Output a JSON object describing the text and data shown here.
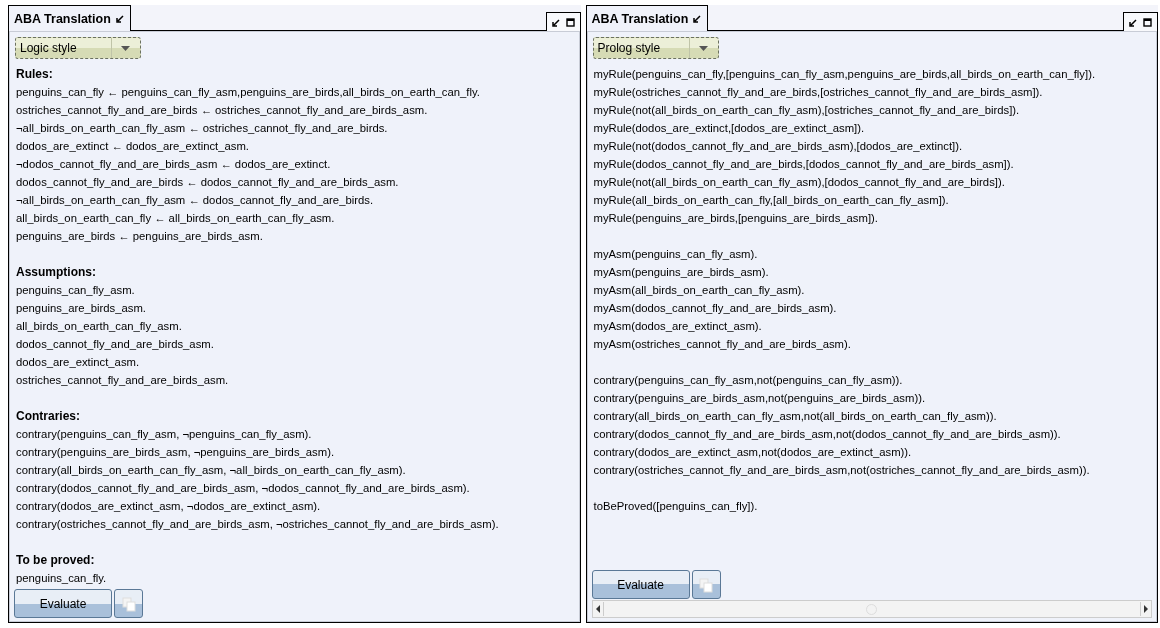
{
  "panels": [
    {
      "title": "ABA Translation",
      "dropdown": "Logic style",
      "has_scrollbar": false,
      "sections": [
        {
          "heading": "Rules:",
          "lines": [
            "penguins_can_fly ← penguins_can_fly_asm,penguins_are_birds,all_birds_on_earth_can_fly.",
            "ostriches_cannot_fly_and_are_birds ← ostriches_cannot_fly_and_are_birds_asm.",
            "¬all_birds_on_earth_can_fly_asm ← ostriches_cannot_fly_and_are_birds.",
            "dodos_are_extinct ← dodos_are_extinct_asm.",
            "¬dodos_cannot_fly_and_are_birds_asm ← dodos_are_extinct.",
            "dodos_cannot_fly_and_are_birds ← dodos_cannot_fly_and_are_birds_asm.",
            "¬all_birds_on_earth_can_fly_asm ← dodos_cannot_fly_and_are_birds.",
            "all_birds_on_earth_can_fly ← all_birds_on_earth_can_fly_asm.",
            "penguins_are_birds ← penguins_are_birds_asm."
          ]
        },
        {
          "heading": "Assumptions:",
          "lines": [
            "penguins_can_fly_asm.",
            "penguins_are_birds_asm.",
            "all_birds_on_earth_can_fly_asm.",
            "dodos_cannot_fly_and_are_birds_asm.",
            "dodos_are_extinct_asm.",
            "ostriches_cannot_fly_and_are_birds_asm."
          ]
        },
        {
          "heading": "Contraries:",
          "lines": [
            "contrary(penguins_can_fly_asm, ¬penguins_can_fly_asm).",
            "contrary(penguins_are_birds_asm, ¬penguins_are_birds_asm).",
            "contrary(all_birds_on_earth_can_fly_asm, ¬all_birds_on_earth_can_fly_asm).",
            "contrary(dodos_cannot_fly_and_are_birds_asm, ¬dodos_cannot_fly_and_are_birds_asm).",
            "contrary(dodos_are_extinct_asm, ¬dodos_are_extinct_asm).",
            "contrary(ostriches_cannot_fly_and_are_birds_asm, ¬ostriches_cannot_fly_and_are_birds_asm)."
          ]
        },
        {
          "heading": "To be proved:",
          "lines": [
            "penguins_can_fly."
          ]
        }
      ],
      "button": "Evaluate"
    },
    {
      "title": "ABA Translation",
      "dropdown": "Prolog style",
      "has_scrollbar": true,
      "sections": [
        {
          "lines": [
            "myRule(penguins_can_fly,[penguins_can_fly_asm,penguins_are_birds,all_birds_on_earth_can_fly]).",
            "myRule(ostriches_cannot_fly_and_are_birds,[ostriches_cannot_fly_and_are_birds_asm]).",
            "myRule(not(all_birds_on_earth_can_fly_asm),[ostriches_cannot_fly_and_are_birds]).",
            "myRule(dodos_are_extinct,[dodos_are_extinct_asm]).",
            "myRule(not(dodos_cannot_fly_and_are_birds_asm),[dodos_are_extinct]).",
            "myRule(dodos_cannot_fly_and_are_birds,[dodos_cannot_fly_and_are_birds_asm]).",
            "myRule(not(all_birds_on_earth_can_fly_asm),[dodos_cannot_fly_and_are_birds]).",
            "myRule(all_birds_on_earth_can_fly,[all_birds_on_earth_can_fly_asm]).",
            "myRule(penguins_are_birds,[penguins_are_birds_asm])."
          ]
        },
        {
          "lines": [
            "myAsm(penguins_can_fly_asm).",
            "myAsm(penguins_are_birds_asm).",
            "myAsm(all_birds_on_earth_can_fly_asm).",
            "myAsm(dodos_cannot_fly_and_are_birds_asm).",
            "myAsm(dodos_are_extinct_asm).",
            "myAsm(ostriches_cannot_fly_and_are_birds_asm)."
          ]
        },
        {
          "lines": [
            "contrary(penguins_can_fly_asm,not(penguins_can_fly_asm)).",
            "contrary(penguins_are_birds_asm,not(penguins_are_birds_asm)).",
            "contrary(all_birds_on_earth_can_fly_asm,not(all_birds_on_earth_can_fly_asm)).",
            "contrary(dodos_cannot_fly_and_are_birds_asm,not(dodos_cannot_fly_and_are_birds_asm)).",
            "contrary(dodos_are_extinct_asm,not(dodos_are_extinct_asm)).",
            "contrary(ostriches_cannot_fly_and_are_birds_asm,not(ostriches_cannot_fly_and_are_birds_asm))."
          ]
        },
        {
          "lines": [
            "toBeProved([penguins_can_fly])."
          ]
        }
      ],
      "button": "Evaluate"
    }
  ]
}
